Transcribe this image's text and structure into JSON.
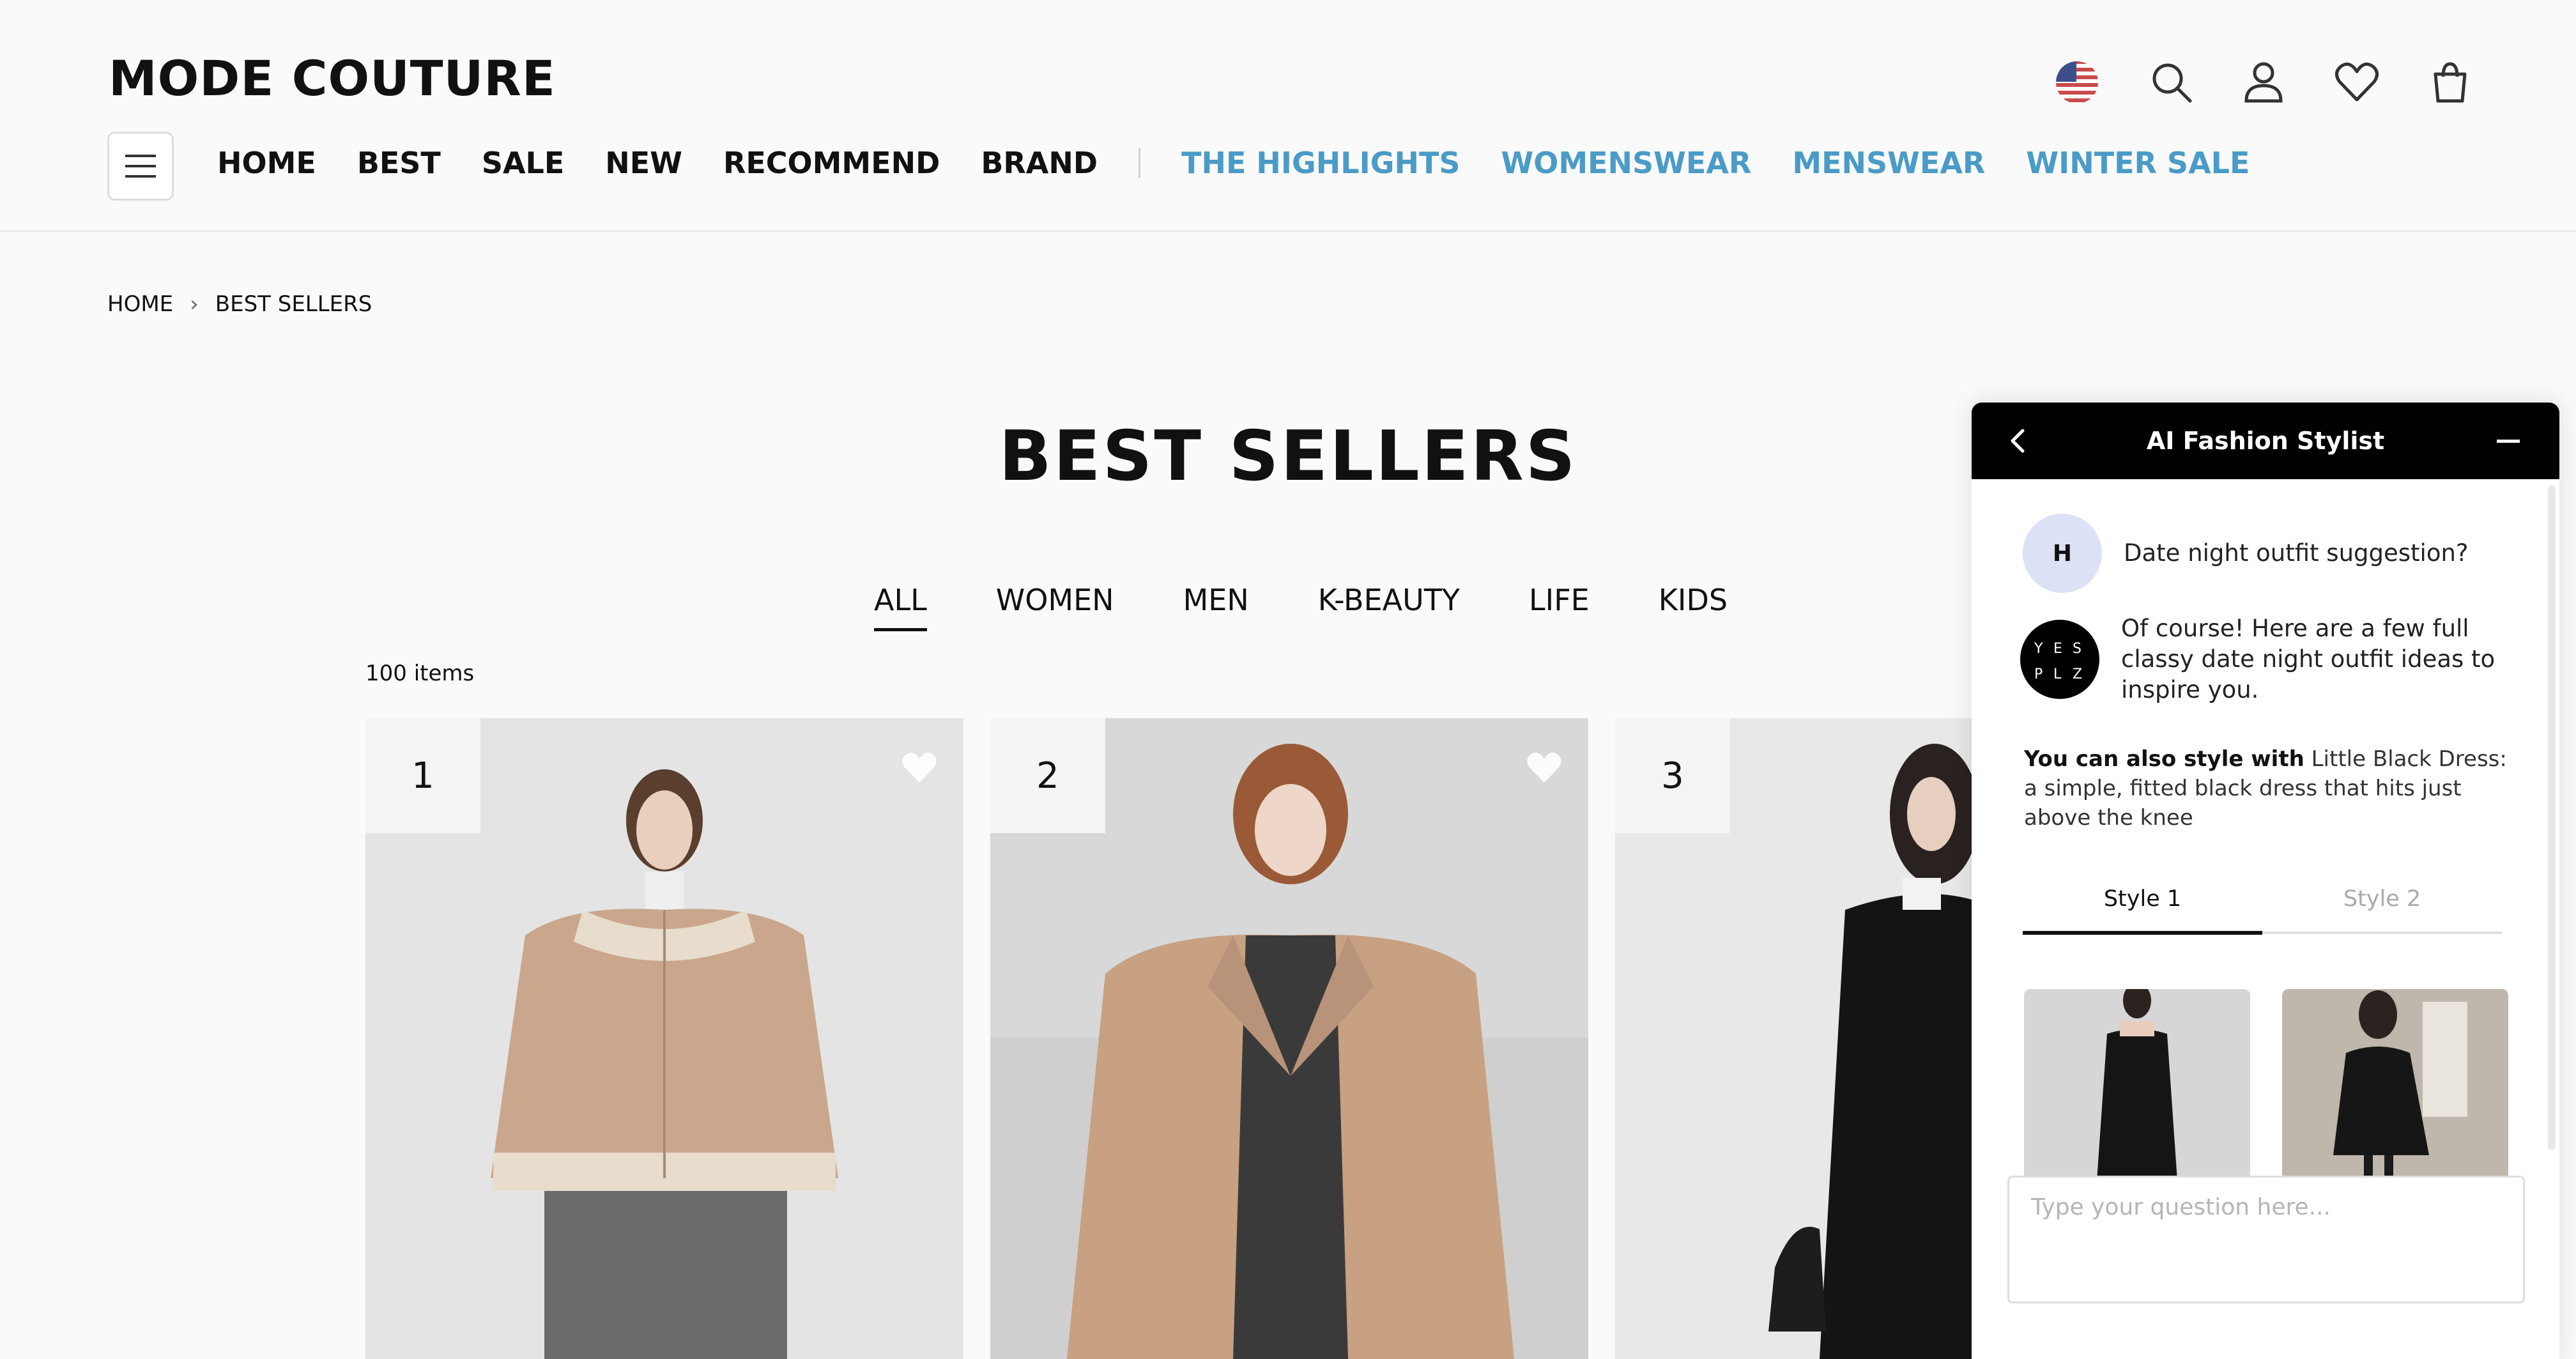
{
  "header": {
    "logo": "MODE COUTURE",
    "nav": [
      {
        "label": "HOME"
      },
      {
        "label": "BEST"
      },
      {
        "label": "SALE"
      },
      {
        "label": "NEW"
      },
      {
        "label": "RECOMMEND"
      },
      {
        "label": "BRAND"
      }
    ],
    "highlights": [
      {
        "label": "THE HIGHLIGHTS"
      },
      {
        "label": "WOMENSWEAR"
      },
      {
        "label": "MENSWEAR"
      },
      {
        "label": "WINTER SALE"
      }
    ],
    "icons": [
      "us-flag-icon",
      "search-icon",
      "user-icon",
      "heart-icon",
      "shopping-bag-icon"
    ]
  },
  "breadcrumb": {
    "home": "HOME",
    "current": "BEST SELLERS"
  },
  "page": {
    "title": "BEST SELLERS",
    "categories": [
      {
        "label": "ALL",
        "active": true
      },
      {
        "label": "WOMEN"
      },
      {
        "label": "MEN"
      },
      {
        "label": "K-BEAUTY"
      },
      {
        "label": "LIFE"
      },
      {
        "label": "KIDS"
      }
    ],
    "item_count": "100 items"
  },
  "products": [
    {
      "rank": "1"
    },
    {
      "rank": "2"
    },
    {
      "rank": "3"
    }
  ],
  "chat": {
    "title": "AI Fashion Stylist",
    "user_initial": "H",
    "user_message": "Date night outfit suggestion?",
    "bot_logo": "YESPLZ",
    "bot_message": "Of course! Here are a few full classy date night outfit ideas to inspire you.",
    "style_lead": "You can also style with",
    "style_text": " Little Black Dress: a simple, fitted black dress that hits just above the knee",
    "tabs": [
      {
        "label": "Style 1",
        "active": true
      },
      {
        "label": "Style 2"
      }
    ],
    "input_placeholder": "Type your question here..."
  }
}
